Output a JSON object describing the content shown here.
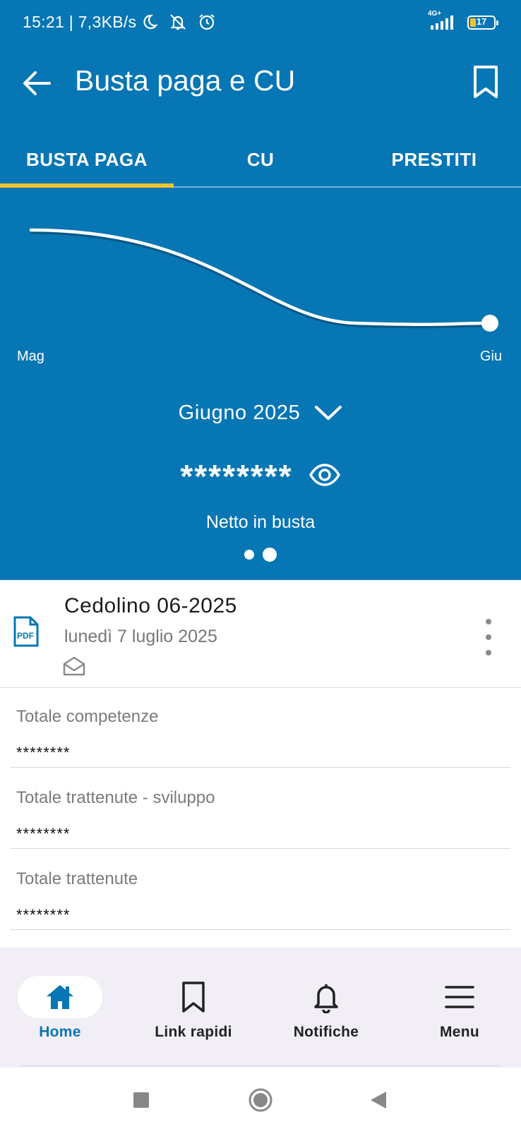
{
  "status_bar": {
    "time": "15:21 | 7,3KB/s",
    "network": "4G+",
    "battery": "17",
    "icons": [
      "moon-icon",
      "bell-off-icon",
      "alarm-icon",
      "signal-icon",
      "battery-icon"
    ]
  },
  "app_bar": {
    "title": "Busta paga e CU",
    "back_icon": "arrow-left-icon",
    "action_icon": "bookmark-icon"
  },
  "tabs": [
    {
      "label": "BUSTA PAGA",
      "active": true
    },
    {
      "label": "CU",
      "active": false
    },
    {
      "label": "PRESTITI",
      "active": false
    }
  ],
  "chart_data": {
    "type": "line",
    "categories": [
      "Mag",
      "Giu"
    ],
    "series": [
      {
        "values": [
          1.0,
          0.0
        ]
      }
    ],
    "note_values_hidden": true
  },
  "summary": {
    "month": "Giugno 2025",
    "amount": "********",
    "amount_label": "Netto in busta",
    "page_dots": 2,
    "active_dot": 1
  },
  "document": {
    "title": "Cedolino 06-2025",
    "date": "lunedì 7 luglio 2025",
    "file_icon_text": "PDF"
  },
  "details": [
    {
      "label": "Totale competenze",
      "value": "********"
    },
    {
      "label": "Totale trattenute - sviluppo",
      "value": "********"
    },
    {
      "label": "Totale trattenute",
      "value": "********"
    }
  ],
  "bottom_nav": [
    {
      "label": "Home",
      "icon": "home-icon",
      "active": true
    },
    {
      "label": "Link rapidi",
      "icon": "bookmark-icon",
      "active": false
    },
    {
      "label": "Notifiche",
      "icon": "bell-icon",
      "active": false
    },
    {
      "label": "Menu",
      "icon": "hamburger-icon",
      "active": false
    }
  ],
  "colors": {
    "primary": "#0776b4",
    "tab_indicator": "#f5c330",
    "nav_background": "#f2eef6"
  }
}
